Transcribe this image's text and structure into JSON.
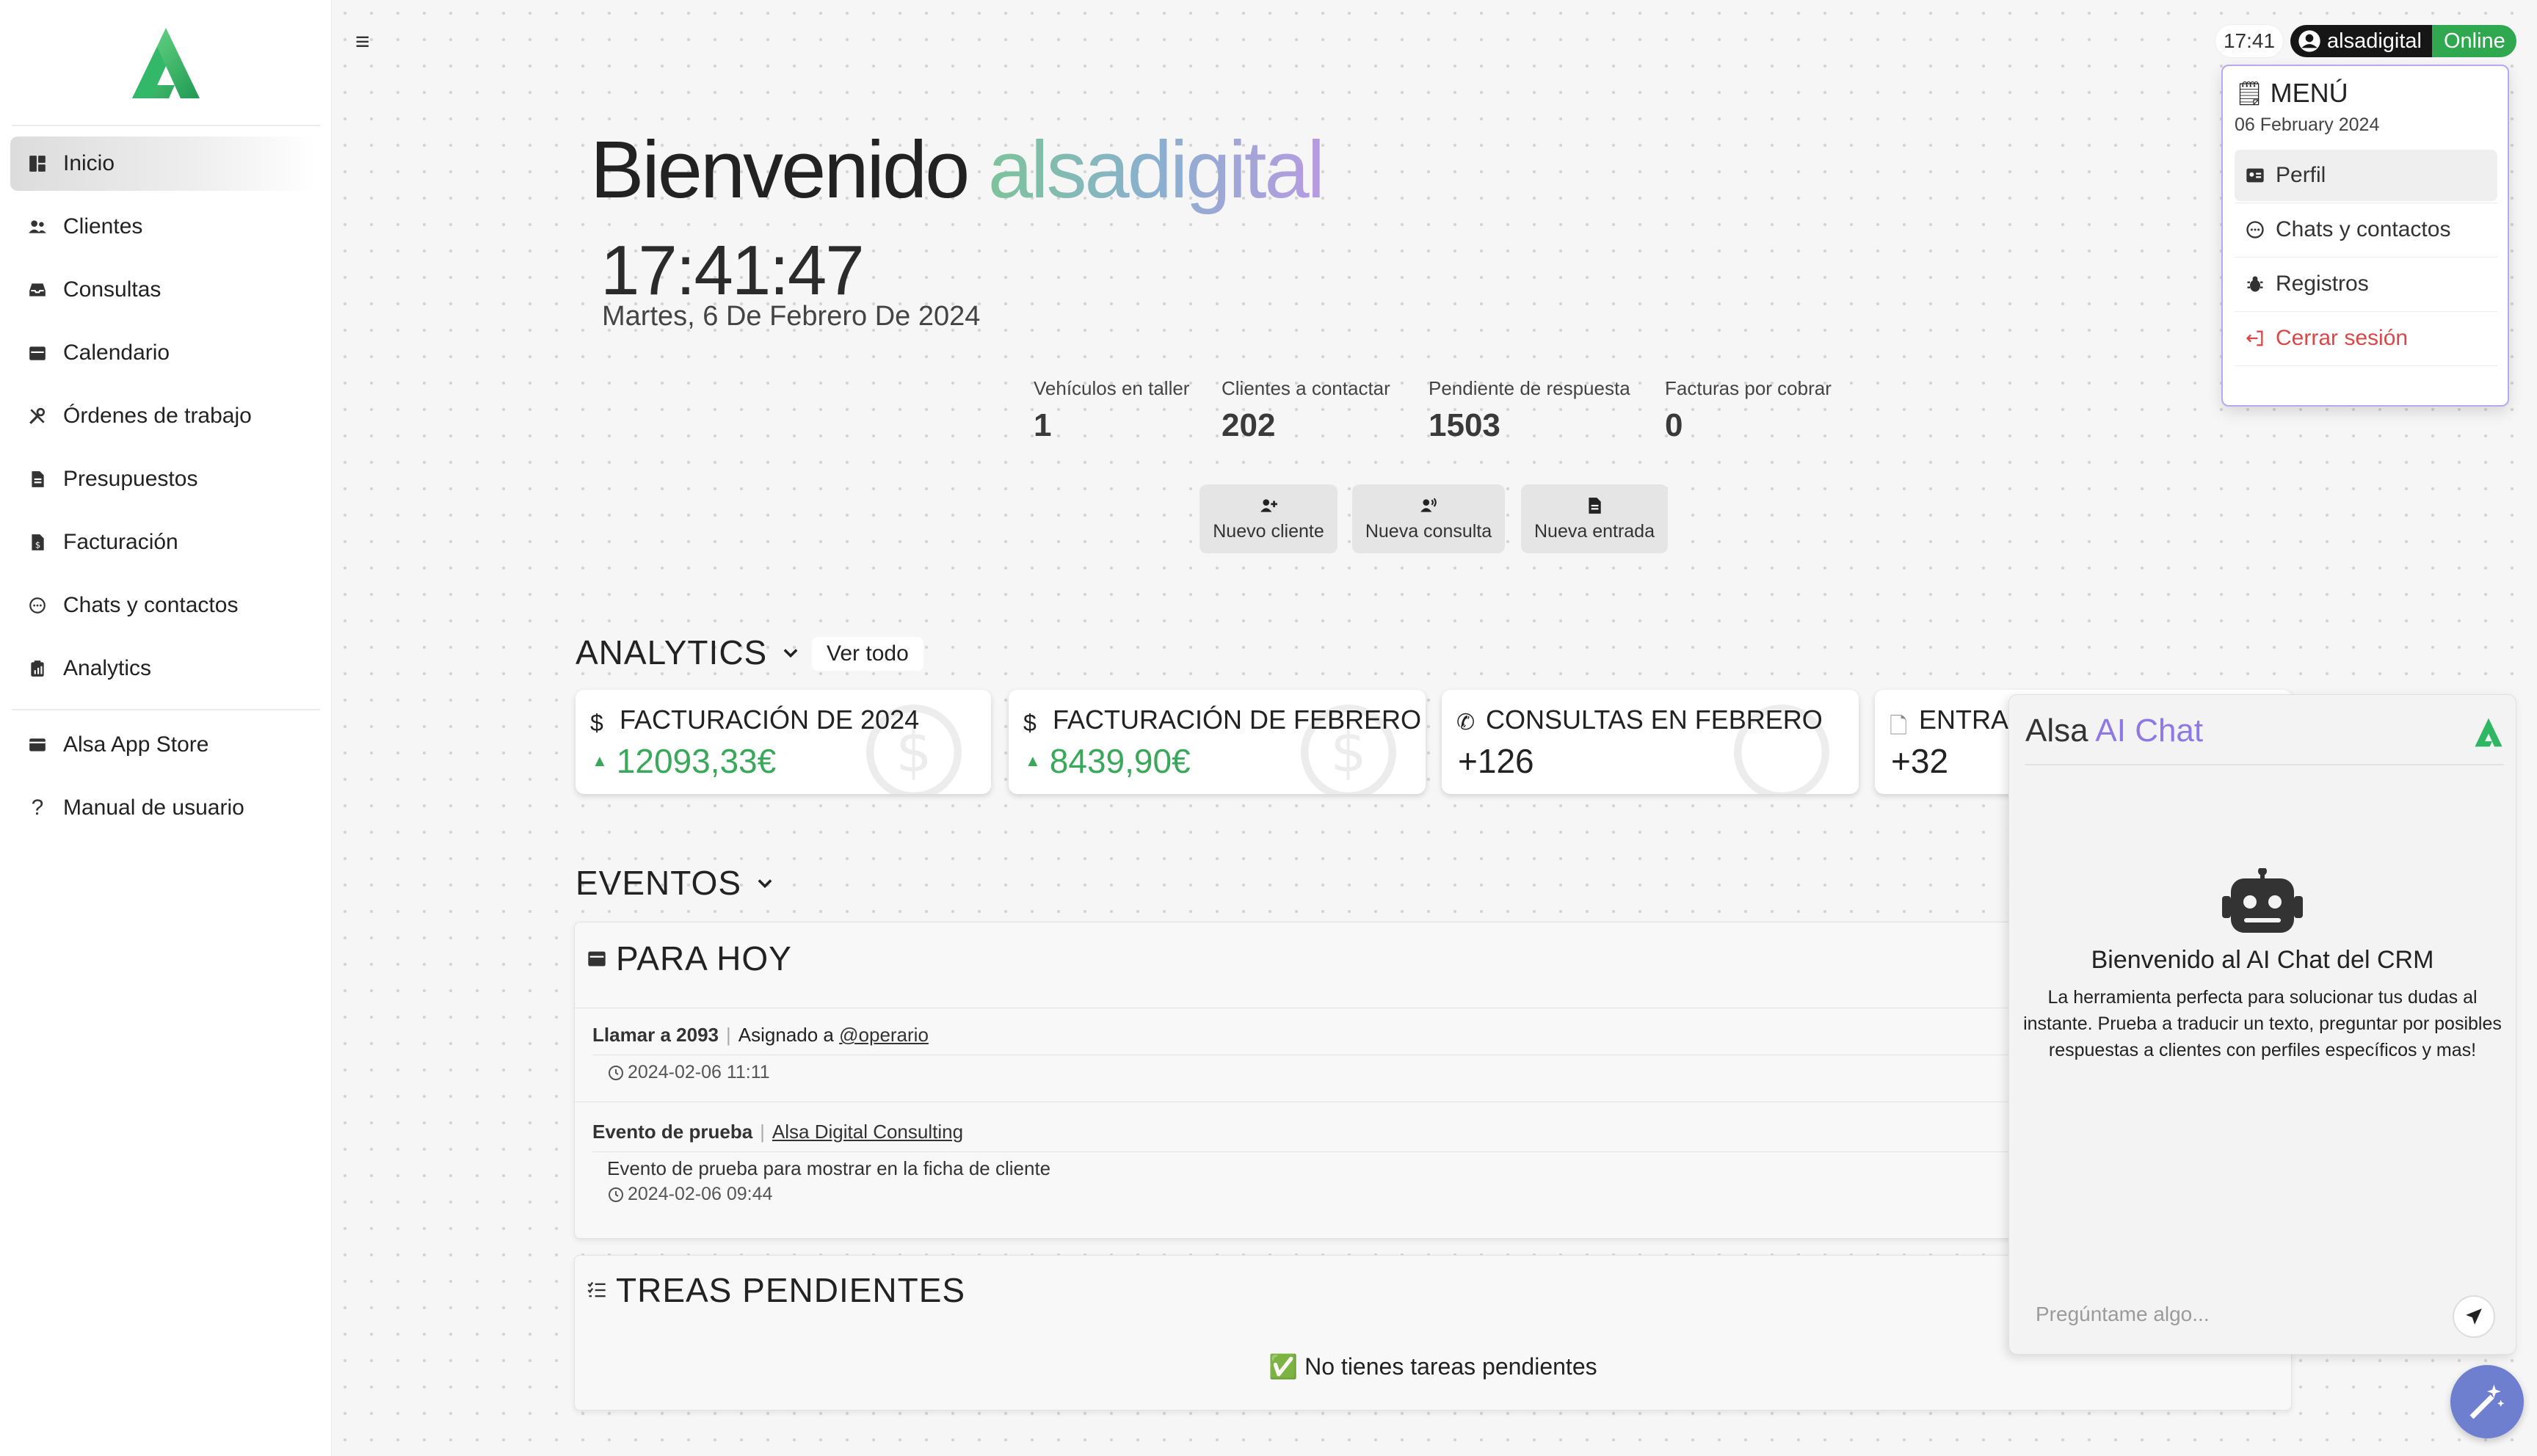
{
  "sidebar": {
    "items": [
      {
        "label": "Inicio"
      },
      {
        "label": "Clientes"
      },
      {
        "label": "Consultas"
      },
      {
        "label": "Calendario"
      },
      {
        "label": "Órdenes de trabajo"
      },
      {
        "label": "Presupuestos"
      },
      {
        "label": "Facturación"
      },
      {
        "label": "Chats y contactos"
      },
      {
        "label": "Analytics"
      },
      {
        "label": "Alsa App Store"
      },
      {
        "label": "Manual de usuario"
      }
    ]
  },
  "topbar": {
    "time": "17:41",
    "username": "alsadigital",
    "status": "Online"
  },
  "header": {
    "welcome_prefix": "Bienvenido",
    "welcome_brand": "alsadigital",
    "clock": "17:41:47",
    "date": "Martes, 6 De Febrero De 2024"
  },
  "stats": [
    {
      "label": "Vehículos en taller",
      "value": "1"
    },
    {
      "label": "Clientes a contactar",
      "value": "202"
    },
    {
      "label": "Pendiente de respuesta",
      "value": "1503"
    },
    {
      "label": "Facturas por cobrar",
      "value": "0"
    }
  ],
  "quick_actions": {
    "new_client": "Nuevo cliente",
    "new_query": "Nueva consulta",
    "new_entry": "Nueva entrada"
  },
  "analytics": {
    "title": "ANALYTICS",
    "see_all": "Ver todo",
    "cards": [
      {
        "title": "FACTURACIÓN DE 2024",
        "value": "12093,33€"
      },
      {
        "title": "FACTURACIÓN DE FEBRERO",
        "value": "8439,90€"
      },
      {
        "title": "CONSULTAS EN FEBRERO",
        "value": "+126"
      },
      {
        "title": "ENTRAD",
        "value": "+32"
      }
    ]
  },
  "events": {
    "title": "EVENTOS",
    "today_title": "PARA HOY",
    "items": [
      {
        "name": "Llamar a 2093",
        "link_prefix": "Asignado a",
        "link": "@operario",
        "description": "",
        "time": "2024-02-06 11:11"
      },
      {
        "name": "Evento de prueba",
        "link_prefix": "",
        "link": "Alsa Digital Consulting",
        "description": "Evento de prueba para mostrar en la ficha de cliente",
        "time": "2024-02-06 09:44"
      }
    ]
  },
  "tasks": {
    "title": "TREAS PENDIENTES",
    "empty": "✅ No tienes tareas pendientes"
  },
  "menu": {
    "title": "MENÚ",
    "date": "06 February 2024",
    "items": [
      {
        "label": "Perfil"
      },
      {
        "label": "Chats y contactos"
      },
      {
        "label": "Registros"
      },
      {
        "label": "Cerrar sesión"
      }
    ]
  },
  "chat": {
    "title_prefix": "Alsa",
    "title_ai": "AI Chat",
    "welcome": "Bienvenido al AI Chat del CRM",
    "description": "La herramienta perfecta para solucionar tus dudas al instante. Prueba a traducir un texto, preguntar por posibles respuestas a clientes con perfiles específicos y mas!",
    "input_placeholder": "Pregúntame algo..."
  },
  "colors": {
    "accent_green": "#3aa85a",
    "online_green": "#2fa84f",
    "ai_purple": "#8d78e6",
    "danger_red": "#d94848",
    "menu_border": "#b8a8ef"
  }
}
